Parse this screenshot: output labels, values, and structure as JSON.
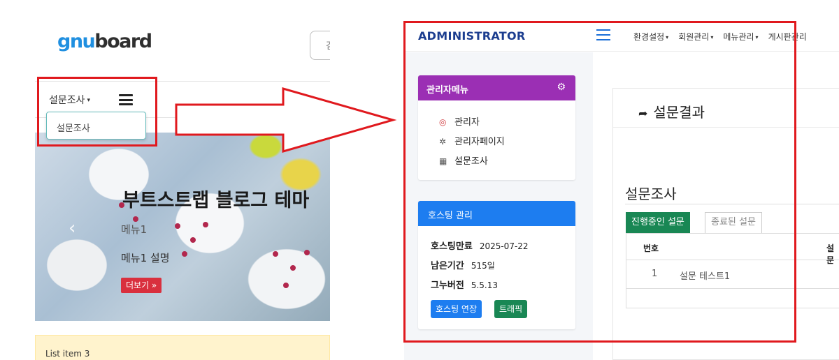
{
  "left": {
    "logo": {
      "part1": "gnu",
      "part2": "board"
    },
    "search_stub": "검",
    "nav": {
      "dropdown_label": "설문조사",
      "caret": "▾"
    },
    "dropdown_item": "설문조사",
    "hero": {
      "title": "부트스트랩 블로그 테마",
      "menu": "메뉴1",
      "description": "메뉴1 설명",
      "more_button": "더보기 »",
      "prev_icon": "‹"
    },
    "list_item": "List item 3"
  },
  "right": {
    "brand": "ADMINISTRATOR",
    "top_nav": [
      {
        "label": "환경설정",
        "caret": "▾"
      },
      {
        "label": "회원관리",
        "caret": "▾"
      },
      {
        "label": "메뉴관리",
        "caret": "▾"
      },
      {
        "label": "게시판관리",
        "caret": ""
      }
    ],
    "admin_menu": {
      "title": "관리자메뉴",
      "gear": "⚙",
      "items": [
        {
          "icon": "◎",
          "label": "관리자"
        },
        {
          "icon": "✲",
          "label": "관리자페이지"
        },
        {
          "icon": "▦",
          "label": "설문조사"
        }
      ]
    },
    "hosting": {
      "title": "호스팅 관리",
      "rows": [
        {
          "label": "호스팅만료",
          "value": "2025-07-22"
        },
        {
          "label": "남은기간",
          "value": "515일"
        },
        {
          "label": "그누버전",
          "value": "5.5.13"
        }
      ],
      "buttons": {
        "extend": "호스팅 연장",
        "traffic": "트래픽"
      }
    },
    "main": {
      "back_arrow": "➦",
      "title": "설문결과",
      "section_title": "설문조사",
      "tabs": {
        "active": "진행중인 설문",
        "inactive": "종료된 설문"
      },
      "table": {
        "headers": [
          "번호",
          "설문"
        ],
        "rows": [
          {
            "no": "1",
            "title": "설문 테스트1"
          }
        ]
      }
    }
  },
  "colors": {
    "highlight_red": "#e0191e",
    "admin_menu_purple": "#9b2fb4",
    "hosting_blue": "#1d7df0",
    "active_tab_green": "#198754",
    "brand_navy": "#1b3d8f"
  }
}
